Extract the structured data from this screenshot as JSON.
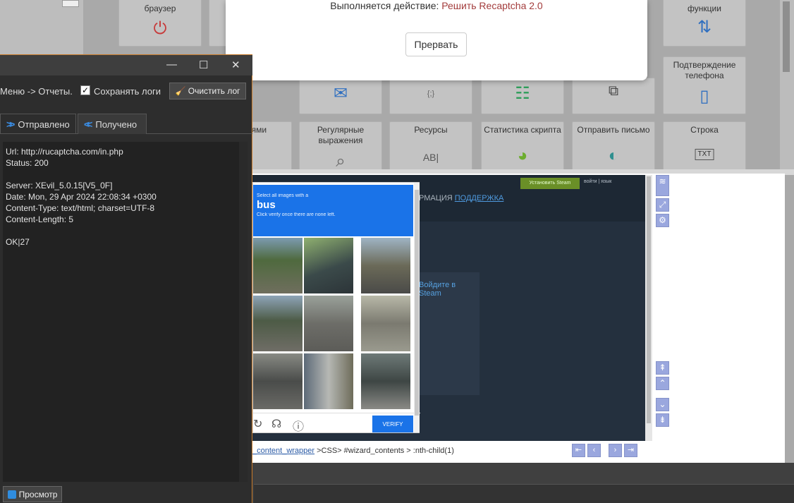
{
  "background": {
    "tiles": [
      {
        "label": "браузер",
        "icon": "power-icon"
      },
      {
        "label": "функции",
        "icon": "fork-arrows-icon"
      },
      {
        "label": "Подтверждение телефона",
        "icon": "phone-icon"
      },
      {
        "label": "",
        "icon": "mail-icon"
      },
      {
        "label": "",
        "icon": "json-icon"
      },
      {
        "label": "",
        "icon": "table-icon"
      },
      {
        "label": "",
        "icon": "files-icon"
      },
      {
        "label": "та с ями",
        "icon": "puzzle-icon"
      },
      {
        "label": "Регулярные выражения",
        "icon": "magnifier-icon"
      },
      {
        "label": "Ресурсы",
        "icon": "text-box-icon"
      },
      {
        "label": "Статистика скрипта",
        "icon": "pie-icon"
      },
      {
        "label": "Отправить письмо",
        "icon": "send-icon"
      },
      {
        "label": "Строка",
        "icon": "txt-icon"
      }
    ]
  },
  "dialog": {
    "status_prefix": "Выполняется действие:",
    "action": "Решить Recaptcha 2.0",
    "abort_label": "Прервать"
  },
  "log": {
    "menu_path": "Меню -> Отчеты.",
    "save_checked": "✓",
    "save_label": "Сохранять логи",
    "clear_label": "Очистить лог",
    "tabs": [
      {
        "label": "Отправлено"
      },
      {
        "label": "Получено"
      }
    ],
    "body": "Url: http://rucaptcha.com/in.php\nStatus: 200\n\nServer: XEvil_5.0.15[V5_0F]\nDate: Mon, 29 Apr 2024 22:08:34 +0300\nContent-Type: text/html; charset=UTF-8\nContent-Length: 5\n\nOK|27",
    "preview_label": "Просмотр"
  },
  "recaptcha": {
    "select_text": "Select all images with a",
    "target_word": "bus",
    "hint": "Click verify once there are none left.",
    "verify_label": "VERIFY"
  },
  "site": {
    "nav_text": "РМАЦИЯ",
    "nav_link": "ПОДДЕРЖКА",
    "box_text": "Войдите в Steam",
    "btn_text": "Установить Steam",
    "top_links": "войти | язык"
  },
  "path_bar": {
    "link": "_content_wrapper",
    "rest": ">CSS> #wizard_contents > :nth-child(1)"
  },
  "colors": {
    "accent_blue": "#1a73e8",
    "log_border": "#c87b2a",
    "action_red": "#a33c3c"
  }
}
